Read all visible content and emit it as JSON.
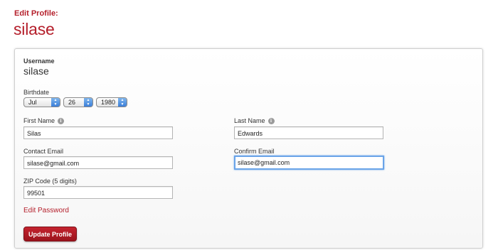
{
  "header": {
    "subtitle": "Edit Profile:",
    "title": "silase"
  },
  "form": {
    "username": {
      "label": "Username",
      "value": "silase"
    },
    "birthdate": {
      "label": "Birthdate",
      "month": "Jul",
      "day": "26",
      "year": "1980"
    },
    "first_name": {
      "label": "First Name",
      "value": "Silas"
    },
    "last_name": {
      "label": "Last Name",
      "value": "Edwards"
    },
    "contact_email": {
      "label": "Contact Email",
      "value": "silase@gmail.com"
    },
    "confirm_email": {
      "label": "Confirm Email",
      "value": "silase@gmail.com"
    },
    "zip": {
      "label": "ZIP Code (5 digits)",
      "value": "99501"
    },
    "edit_password_link": "Edit Password",
    "submit_label": "Update Profile"
  },
  "icons": {
    "info": "info-icon",
    "select_arrow": "updown-arrow-icon"
  },
  "colors": {
    "brand_red": "#b41e2a",
    "focus_blue": "#6aa4e8",
    "select_blue": "#3b7ed8"
  }
}
